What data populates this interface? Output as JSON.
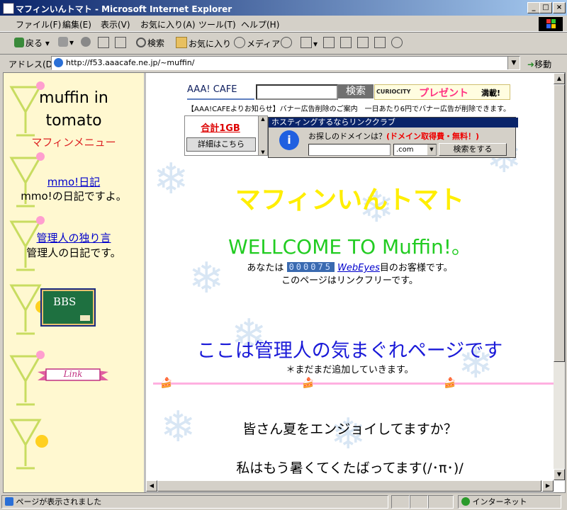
{
  "window": {
    "title": "マフィンいんトマト - Microsoft Internet Explorer"
  },
  "menu": [
    "ファイル(F)",
    "編集(E)",
    "表示(V)",
    "お気に入り(A)",
    "ツール(T)",
    "ヘルプ(H)"
  ],
  "toolbar": {
    "back": "戻る",
    "search": "検索",
    "favorites": "お気に入り",
    "media": "メディア"
  },
  "address": {
    "label": "アドレス(D)",
    "url": "http://f53.aaacafe.ne.jp/~muffin/",
    "go": "移動"
  },
  "left": {
    "title_line1": "muffin in",
    "title_line2": "tomato",
    "menu_heading": "マフィンメニュー",
    "diary_link": "mmo!日記",
    "diary_desc": "mmo!の日記ですよ。",
    "admin_link": "管理人の独り言",
    "admin_desc": "管理人の日記です。",
    "bbs_label": "BBS",
    "link_label": "Link"
  },
  "banner": {
    "brand": "AAA! CAFE",
    "search_btn": "検索",
    "curiocity": "CURIOCITY",
    "present": "プレゼント",
    "present_suffix": "満載!",
    "notice": "【AAA!CAFEよりお知らせ】バナー広告削除のご案内　一日あたり6円でバナー広告が削除できます。",
    "total": "合計1GB",
    "details": "詳細はこちら",
    "hosting_title": "ホスティングするならリンククラブ",
    "domain_q": "お探しのドメインは？",
    "domain_free": "(ドメイン取得費・無料！)",
    "tld": ".com",
    "domain_btn": "検索をする"
  },
  "main": {
    "title": "マフィンいんトマト",
    "welcome": "WELLCOME TO Muffin!。",
    "counter_prefix": "あなたは",
    "counter_value": "000075",
    "webeyes": "WebEyes",
    "counter_suffix": "目のお客様です。",
    "linkfree": "このページはリンクフリーです。",
    "heading2": "ここは管理人の気まぐれページです",
    "sub": "＊まだまだ追加していきます。",
    "line1": "皆さん夏をエンジョイしてますか？",
    "line2": "私はもう暑くてくたばってます(/･π･)/"
  },
  "status": {
    "text": "ページが表示されました",
    "zone": "インターネット"
  },
  "colors": {
    "main_title": "#ffee00",
    "welcome": "#22cc22",
    "heading2": "#1a1ad8",
    "left_bg": "#fff8d0",
    "menu_heading": "#dd2222"
  }
}
